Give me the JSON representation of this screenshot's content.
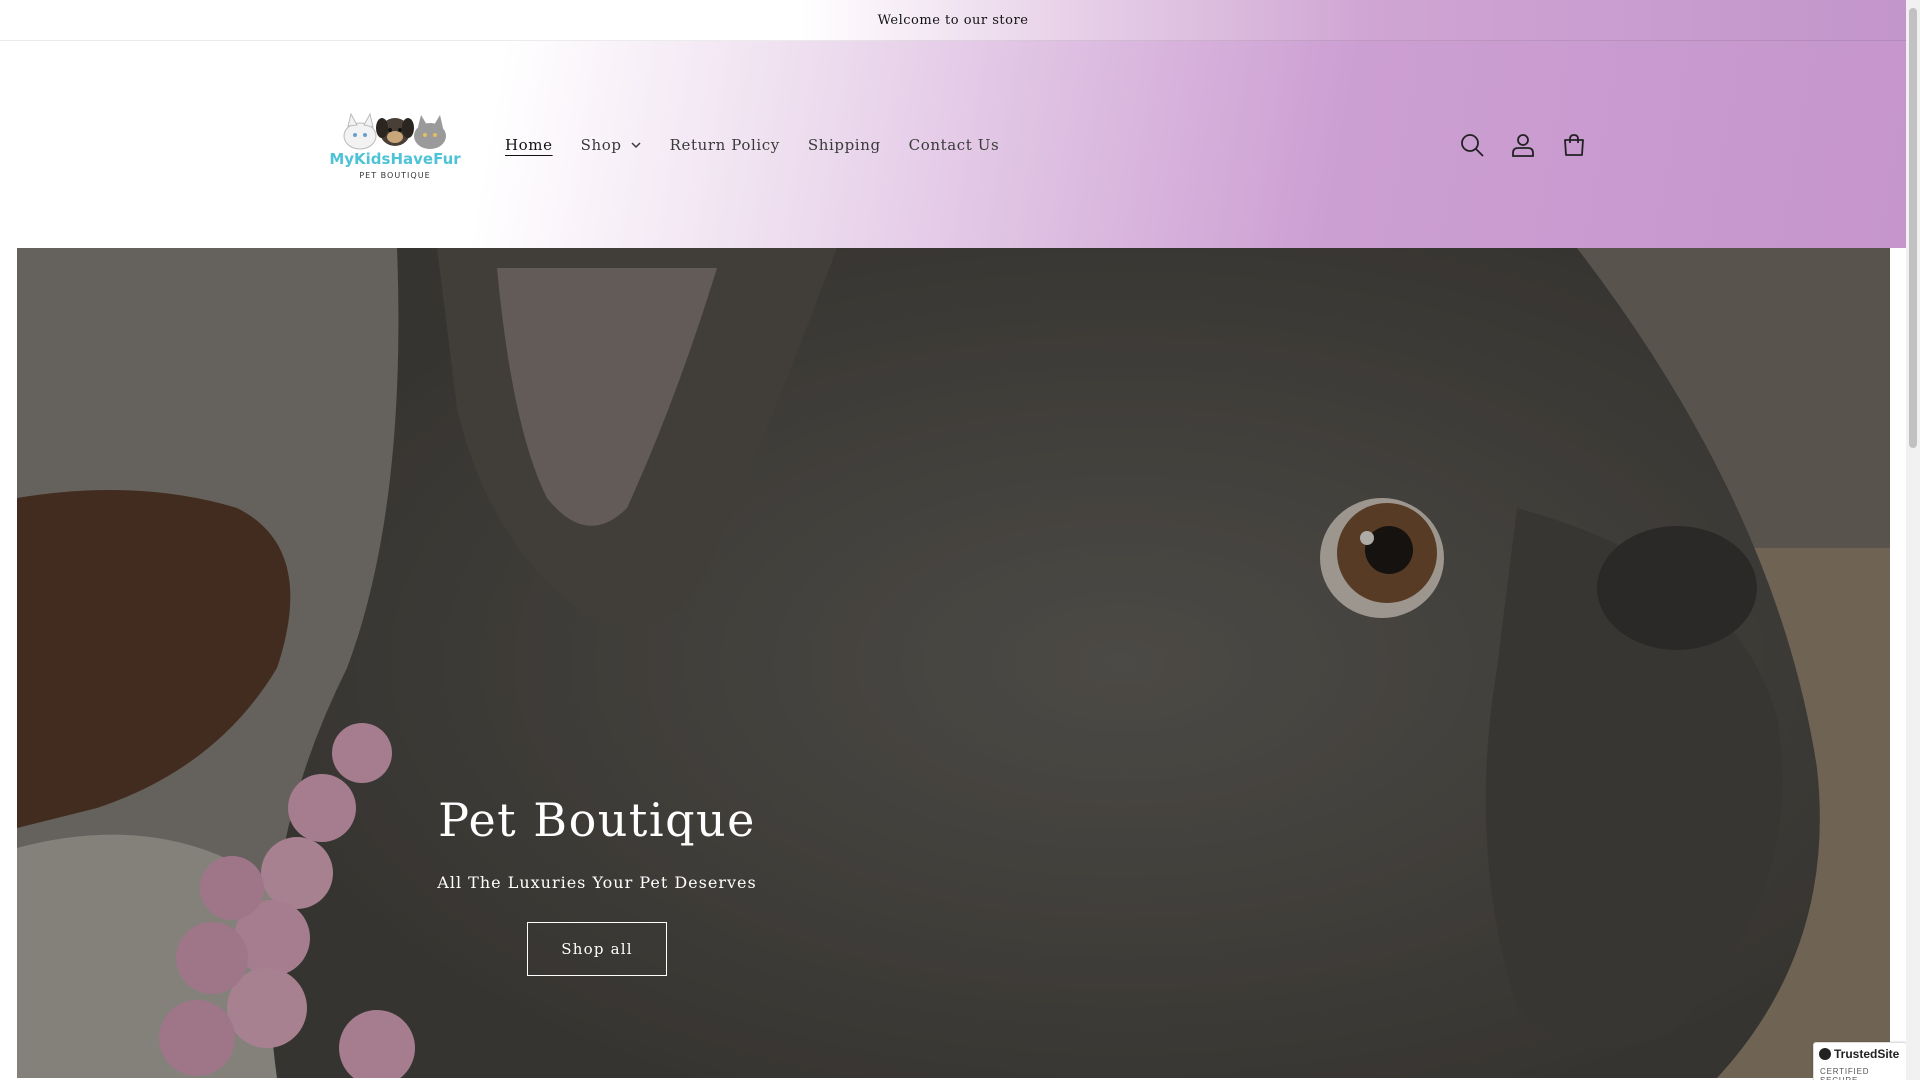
{
  "announcement": {
    "text": "Welcome to our store"
  },
  "header": {
    "logo_icon": "mykidshavefur-logo",
    "logo_lines": [
      "MyKidsHaveFur",
      "PET BOUTIQUE"
    ],
    "nav": [
      {
        "label": "Home",
        "active": true
      },
      {
        "label": "Shop",
        "has_dropdown": true
      },
      {
        "label": "Return Policy"
      },
      {
        "label": "Shipping"
      },
      {
        "label": "Contact Us"
      }
    ],
    "icons": [
      "search-icon",
      "account-icon",
      "cart-icon"
    ]
  },
  "hero": {
    "title": "Pet Boutique",
    "subtitle": "All The Luxuries Your Pet Deserves",
    "button_label": "Shop all",
    "image": "french-bulldog-photo"
  },
  "badge": {
    "title": "TrustedSite",
    "subtitle": "CERTIFIED SECURE"
  },
  "colors": {
    "header_gradient_end": "#c595cc",
    "hero_overlay": "#55524d",
    "text_primary": "#121212"
  }
}
